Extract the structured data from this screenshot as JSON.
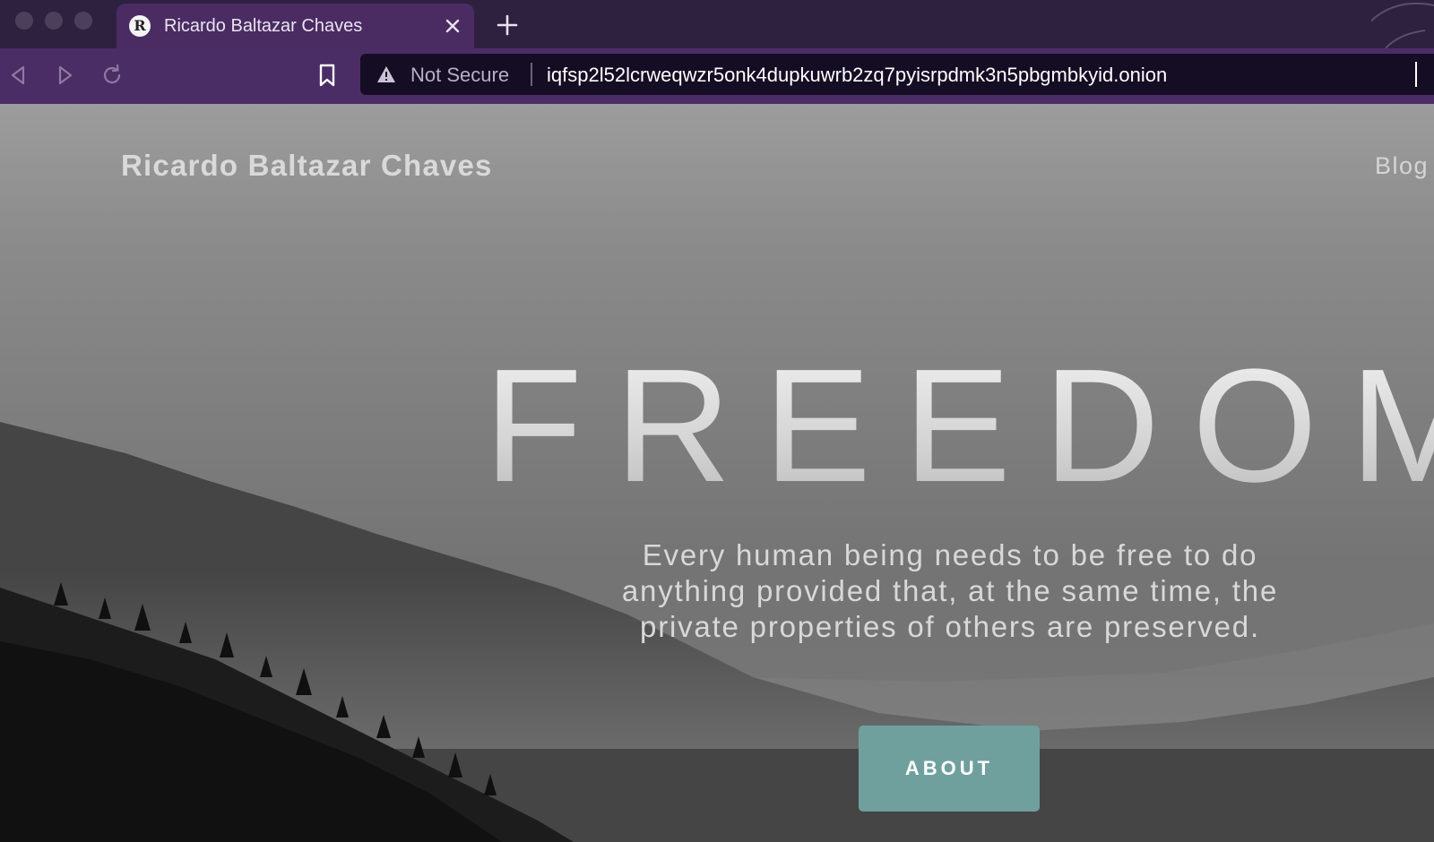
{
  "browser": {
    "tab": {
      "favicon_glyph": "R",
      "title": "Ricardo Baltazar Chaves"
    },
    "address_bar": {
      "security_label": "Not Secure",
      "url": "iqfsp2l52lcrweqwzr5onk4dupkuwrb2zq7pyisrpdmk3n5pbgmbkyid.onion"
    }
  },
  "site": {
    "title": "Ricardo Baltazar Chaves",
    "nav": {
      "blog": "Blog"
    },
    "hero": {
      "heading": "FREEDOM",
      "text": "Every human being needs to be free to do anything provided that, at the same time, the private properties of others are preserved.",
      "button": "ABOUT"
    }
  },
  "colors": {
    "tab_strip": "#2e2140",
    "toolbar": "#4b2d66",
    "url_bar": "#150d24",
    "accent_button": "#6fa09e"
  },
  "icons": [
    "close-icon",
    "plus-icon",
    "back-arrow-icon",
    "forward-arrow-icon",
    "reload-icon",
    "bookmark-icon",
    "warning-icon"
  ]
}
